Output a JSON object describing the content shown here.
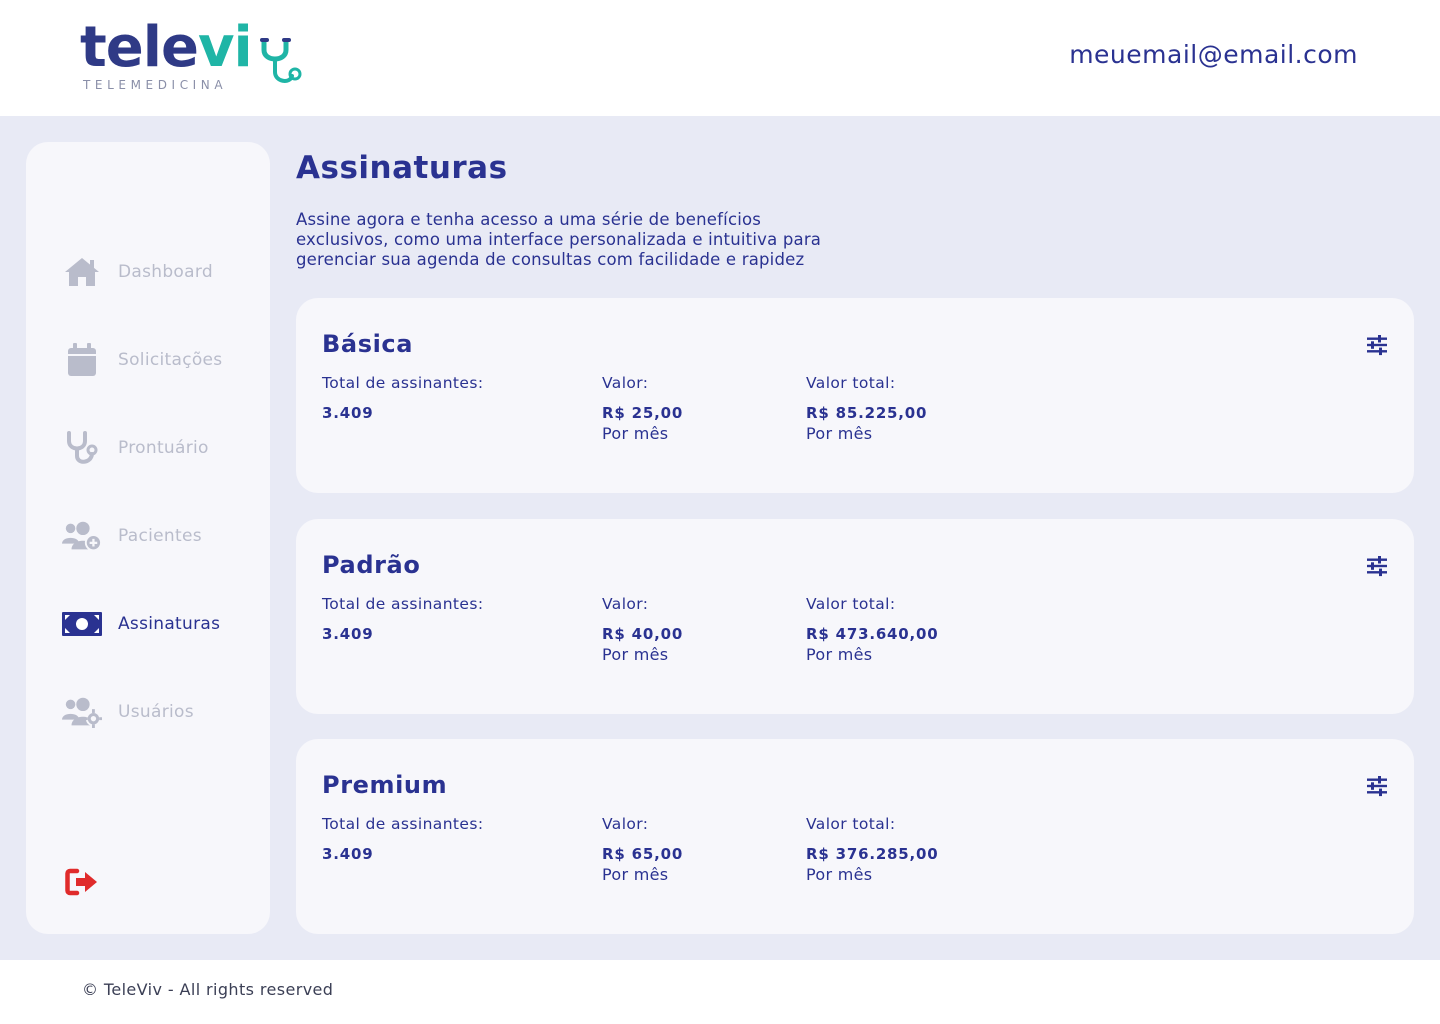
{
  "brand": {
    "name_part1": "tele",
    "name_part2": "vi",
    "subtitle": "TELEMEDICINA",
    "color_primary": "#2f3a86",
    "color_accent": "#1fb5a6"
  },
  "header": {
    "user_email": "meuemail@email.com"
  },
  "sidebar": {
    "items": [
      {
        "label": "Dashboard",
        "icon": "home-icon",
        "active": false
      },
      {
        "label": "Solicitações",
        "icon": "calendar-icon",
        "active": false
      },
      {
        "label": "Prontuário",
        "icon": "stethoscope-icon",
        "active": false
      },
      {
        "label": "Pacientes",
        "icon": "users-plus-icon",
        "active": false
      },
      {
        "label": "Assinaturas",
        "icon": "money-bill-icon",
        "active": true
      },
      {
        "label": "Usuários",
        "icon": "users-gear-icon",
        "active": false
      }
    ],
    "logout_icon": "logout-icon",
    "logout_color": "#e02b2b"
  },
  "page": {
    "title": "Assinaturas",
    "description": "Assine agora e tenha acesso a uma série de benefícios exclusivos, como uma interface personalizada e intuitiva para gerenciar sua agenda de consultas com facilidade e rapidez"
  },
  "plans": [
    {
      "name": "Básica",
      "subscribers_label": "Total de assinantes:",
      "subscribers": "3.409",
      "price_label": "Valor:",
      "price": "R$ 25,00",
      "price_period": "Por mês",
      "total_label": "Valor total:",
      "total": "R$ 85.225,00",
      "total_period": "Por mês"
    },
    {
      "name": "Padrão",
      "subscribers_label": "Total de assinantes:",
      "subscribers": "3.409",
      "price_label": "Valor:",
      "price": "R$ 40,00",
      "price_period": "Por mês",
      "total_label": "Valor total:",
      "total": "R$ 473.640,00",
      "total_period": "Por mês"
    },
    {
      "name": "Premium",
      "subscribers_label": "Total de assinantes:",
      "subscribers": "3.409",
      "price_label": "Valor:",
      "price": "R$ 65,00",
      "price_period": "Por mês",
      "total_label": "Valor total:",
      "total": "R$ 376.285,00",
      "total_period": "Por mês"
    }
  ],
  "footer": {
    "copyright": "© TeleViv - All rights reserved"
  }
}
